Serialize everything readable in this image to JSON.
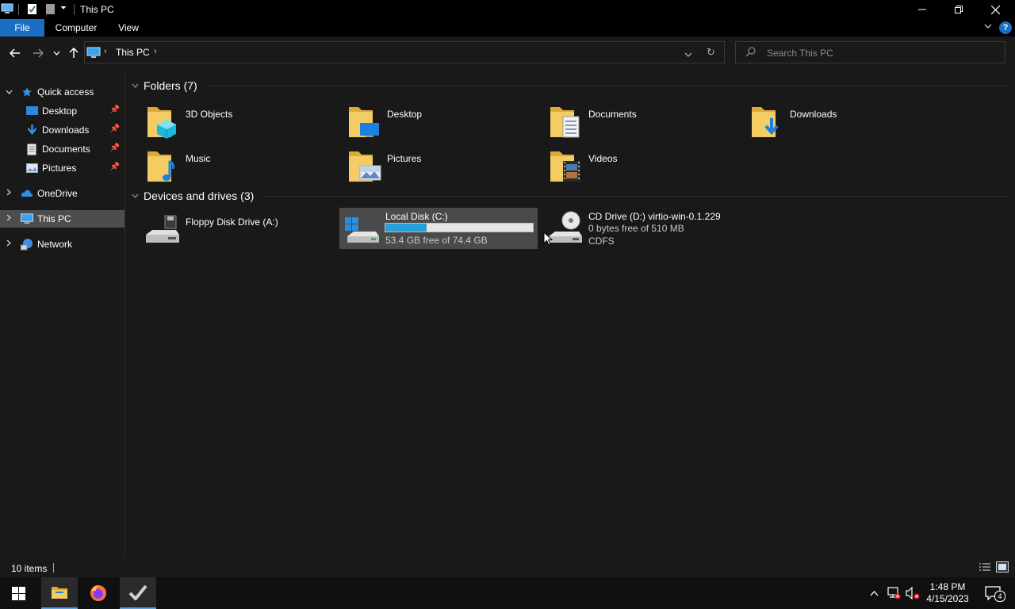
{
  "window": {
    "title": "This PC"
  },
  "ribbon": {
    "tabs": [
      "File",
      "Computer",
      "View"
    ]
  },
  "address": {
    "path": "This PC",
    "search_placeholder": "Search This PC"
  },
  "sidebar": {
    "quick_access": "Quick access",
    "pinned": [
      "Desktop",
      "Downloads",
      "Documents",
      "Pictures"
    ],
    "onedrive": "OneDrive",
    "this_pc": "This PC",
    "network": "Network"
  },
  "folders": {
    "header": "Folders (7)",
    "items": [
      "3D Objects",
      "Desktop",
      "Documents",
      "Downloads",
      "Music",
      "Pictures",
      "Videos"
    ]
  },
  "drives": {
    "header": "Devices and drives (3)",
    "floppy": {
      "name": "Floppy Disk Drive (A:)"
    },
    "local": {
      "name": "Local Disk (C:)",
      "free": "53.4 GB free of 74.4 GB",
      "used_fraction": 0.282
    },
    "cd": {
      "name": "CD Drive (D:) virtio-win-0.1.229",
      "free": "0 bytes free of 510 MB",
      "fs": "CDFS"
    }
  },
  "status": {
    "items": "10 items"
  },
  "taskbar": {
    "time": "1:48 PM",
    "date": "4/15/2023",
    "notifications": "4"
  },
  "colors": {
    "accent": "#1a6fc4",
    "folder": "#e8c35a",
    "progress": "#26a0da",
    "selection": "#4d4d4d"
  }
}
